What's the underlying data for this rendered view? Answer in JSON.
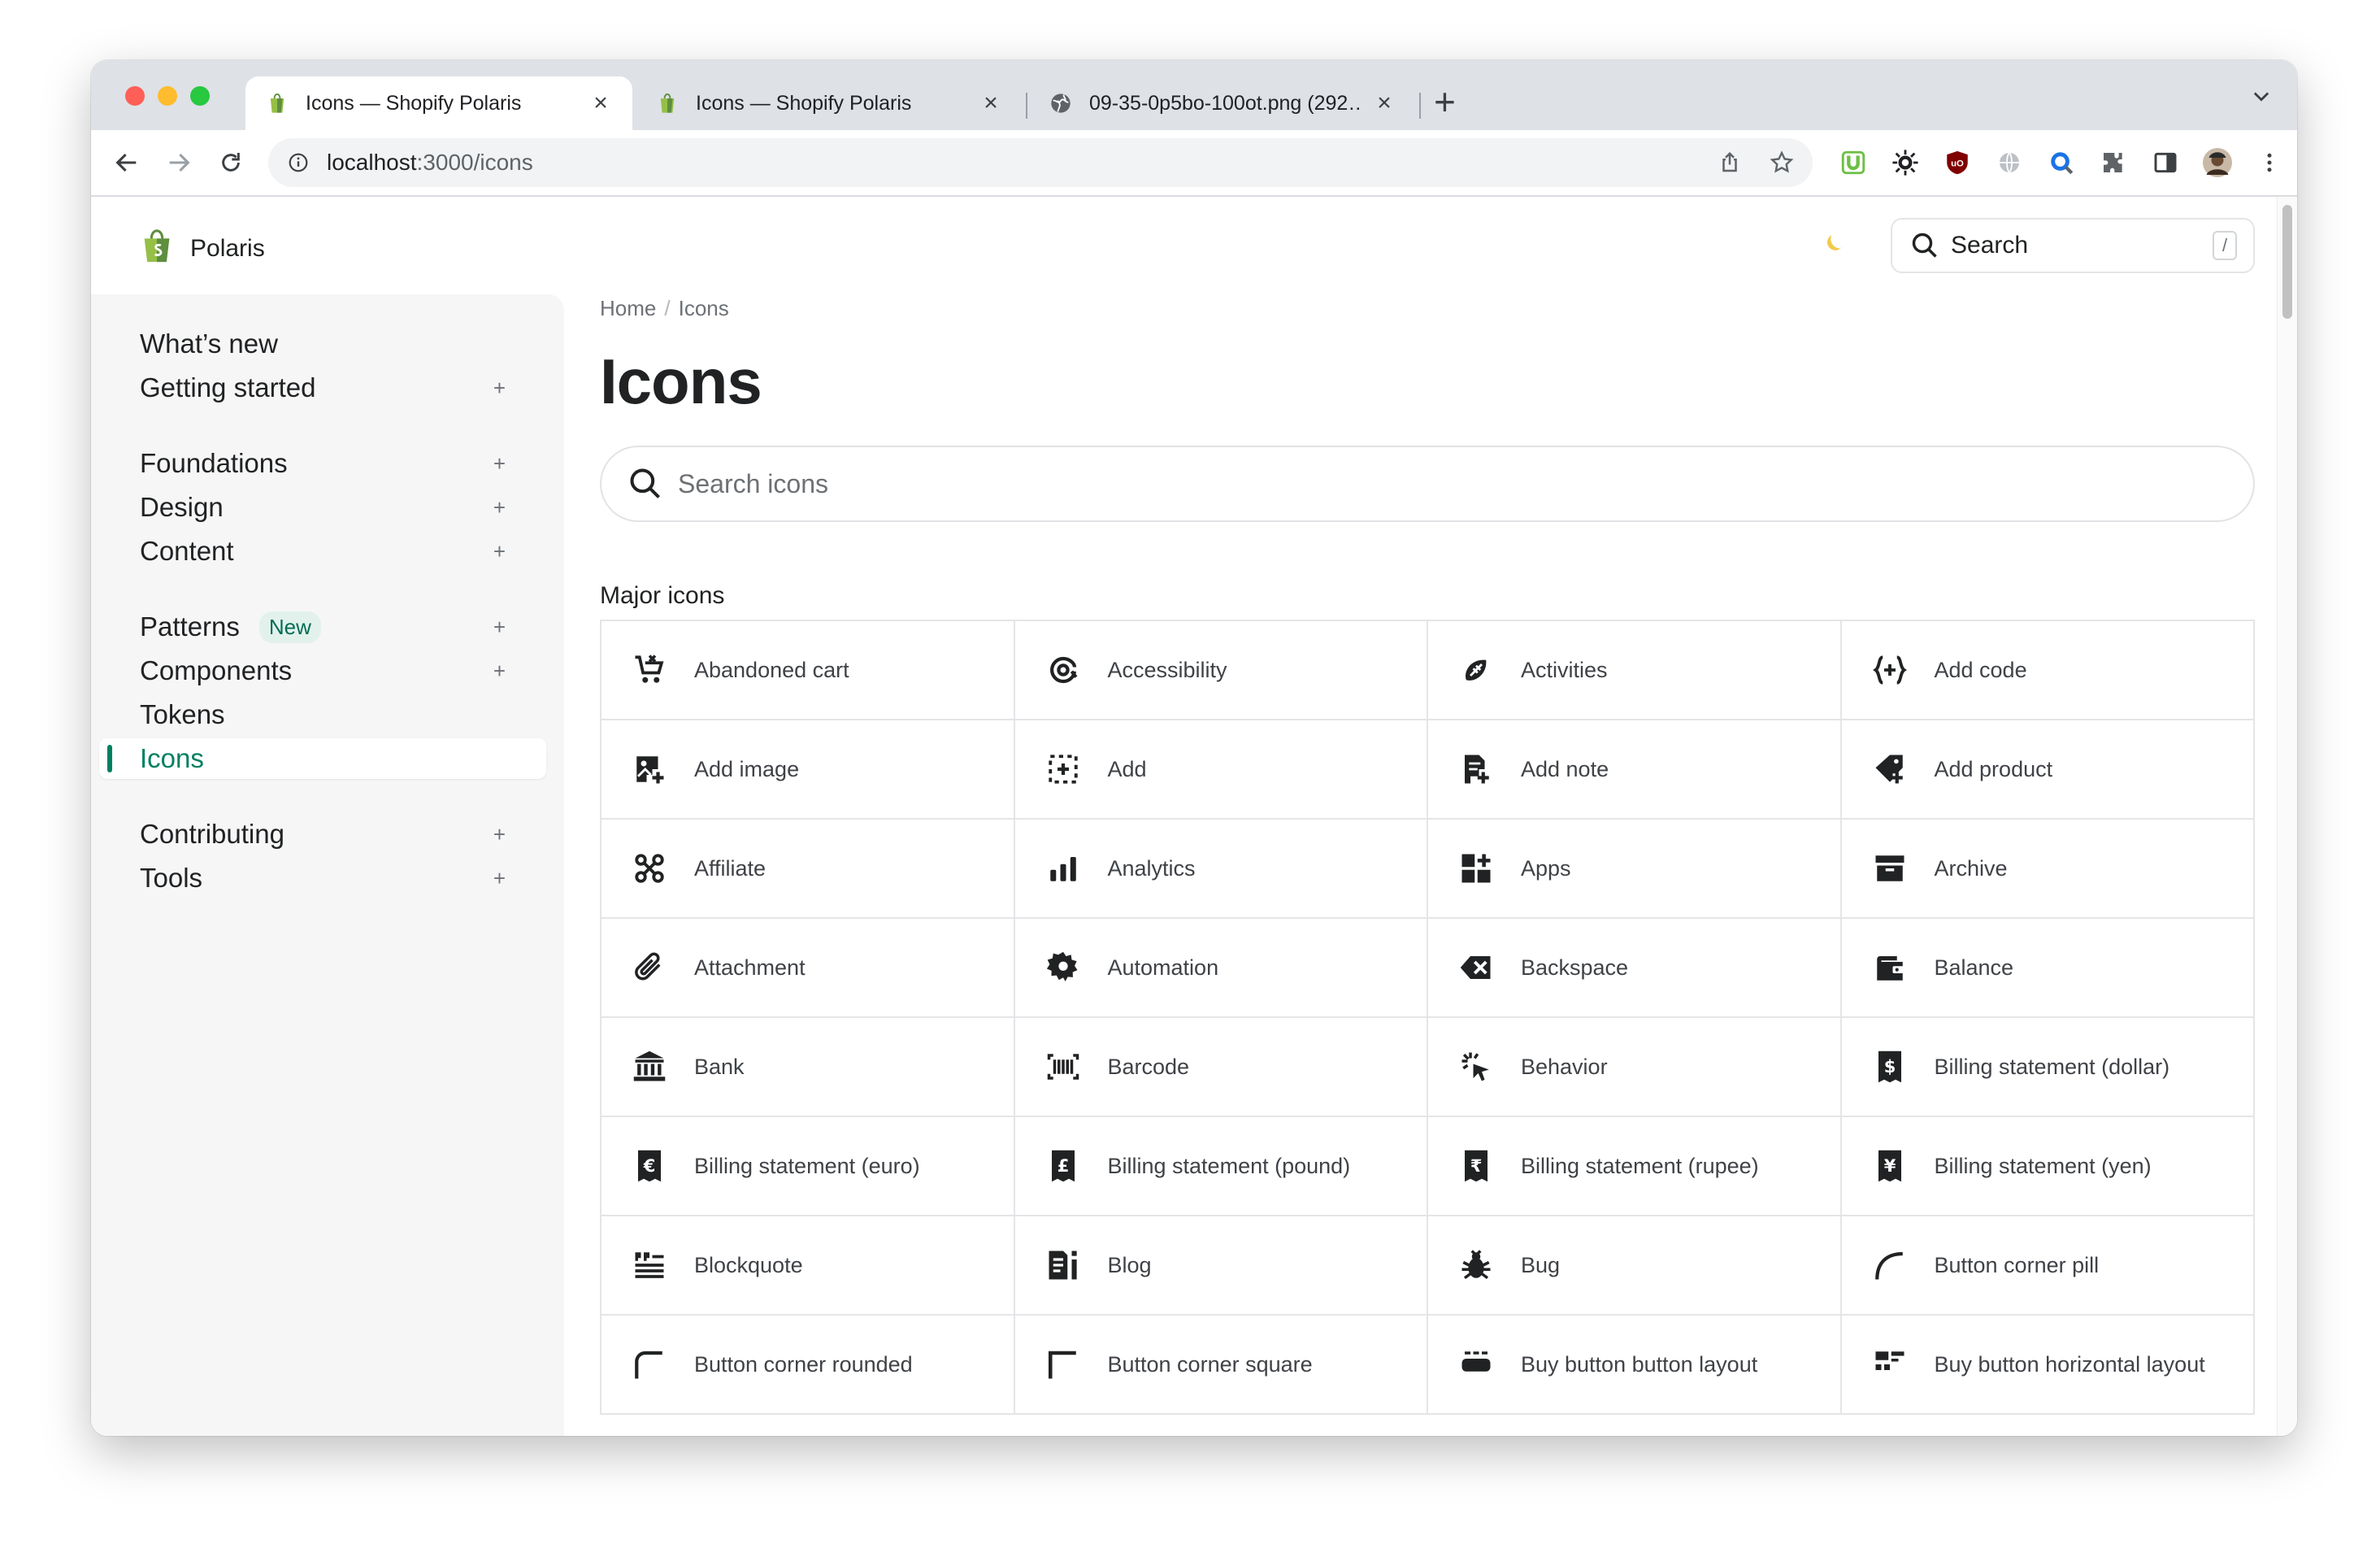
{
  "browser": {
    "tabs": [
      {
        "title": "Icons — Shopify Polaris",
        "favicon": "shopify-bag-icon",
        "active": true
      },
      {
        "title": "Icons — Shopify Polaris",
        "favicon": "shopify-bag-icon",
        "active": false
      },
      {
        "title": "09-35-0p5bo-100ot.png (292…",
        "favicon": "globe-icon",
        "active": false
      }
    ],
    "url_host": "localhost",
    "url_path": ":3000/icons"
  },
  "site": {
    "logo_text": "Polaris",
    "search_label": "Search",
    "search_shortcut": "/"
  },
  "sidebar": {
    "items": [
      {
        "label": "What’s new",
        "expandable": false
      },
      {
        "label": "Getting started",
        "expandable": true
      },
      {
        "label": "Foundations",
        "expandable": true
      },
      {
        "label": "Design",
        "expandable": true
      },
      {
        "label": "Content",
        "expandable": true
      },
      {
        "label": "Patterns",
        "expandable": true,
        "badge": "New"
      },
      {
        "label": "Components",
        "expandable": true
      },
      {
        "label": "Tokens",
        "expandable": false
      },
      {
        "label": "Icons",
        "expandable": false,
        "active": true
      },
      {
        "label": "Contributing",
        "expandable": true
      },
      {
        "label": "Tools",
        "expandable": true
      }
    ],
    "expand_symbol": "+"
  },
  "main": {
    "breadcrumb": {
      "home": "Home",
      "separator": "/",
      "current": "Icons"
    },
    "title": "Icons",
    "search_placeholder": "Search icons",
    "section_title": "Major icons",
    "icons": [
      {
        "name": "Abandoned cart",
        "icon": "abandoned-cart-icon"
      },
      {
        "name": "Accessibility",
        "icon": "accessibility-icon"
      },
      {
        "name": "Activities",
        "icon": "activities-icon"
      },
      {
        "name": "Add code",
        "icon": "add-code-icon"
      },
      {
        "name": "Add image",
        "icon": "add-image-icon"
      },
      {
        "name": "Add",
        "icon": "add-icon"
      },
      {
        "name": "Add note",
        "icon": "add-note-icon"
      },
      {
        "name": "Add product",
        "icon": "add-product-icon"
      },
      {
        "name": "Affiliate",
        "icon": "affiliate-icon"
      },
      {
        "name": "Analytics",
        "icon": "analytics-icon"
      },
      {
        "name": "Apps",
        "icon": "apps-icon"
      },
      {
        "name": "Archive",
        "icon": "archive-icon"
      },
      {
        "name": "Attachment",
        "icon": "attachment-icon"
      },
      {
        "name": "Automation",
        "icon": "automation-icon"
      },
      {
        "name": "Backspace",
        "icon": "backspace-icon"
      },
      {
        "name": "Balance",
        "icon": "balance-icon"
      },
      {
        "name": "Bank",
        "icon": "bank-icon"
      },
      {
        "name": "Barcode",
        "icon": "barcode-icon"
      },
      {
        "name": "Behavior",
        "icon": "behavior-icon"
      },
      {
        "name": "Billing statement (dollar)",
        "icon": "billing-statement-dollar-icon",
        "glyph": "$"
      },
      {
        "name": "Billing statement (euro)",
        "icon": "billing-statement-euro-icon",
        "glyph": "€"
      },
      {
        "name": "Billing statement (pound)",
        "icon": "billing-statement-pound-icon",
        "glyph": "£"
      },
      {
        "name": "Billing statement (rupee)",
        "icon": "billing-statement-rupee-icon",
        "glyph": "₹"
      },
      {
        "name": "Billing statement (yen)",
        "icon": "billing-statement-yen-icon",
        "glyph": "¥"
      },
      {
        "name": "Blockquote",
        "icon": "blockquote-icon"
      },
      {
        "name": "Blog",
        "icon": "blog-icon"
      },
      {
        "name": "Bug",
        "icon": "bug-icon"
      },
      {
        "name": "Button corner pill",
        "icon": "button-corner-pill-icon"
      },
      {
        "name": "Button corner rounded",
        "icon": "button-corner-rounded-icon"
      },
      {
        "name": "Button corner square",
        "icon": "button-corner-square-icon"
      },
      {
        "name": "Buy button button layout",
        "icon": "buy-button-layout-icon"
      },
      {
        "name": "Buy button horizontal layout",
        "icon": "buy-button-horizontal-layout-icon"
      }
    ]
  },
  "colors": {
    "accent": "#008060",
    "sidebar_bg": "#f6f6f7",
    "border": "#e4e5e7"
  }
}
